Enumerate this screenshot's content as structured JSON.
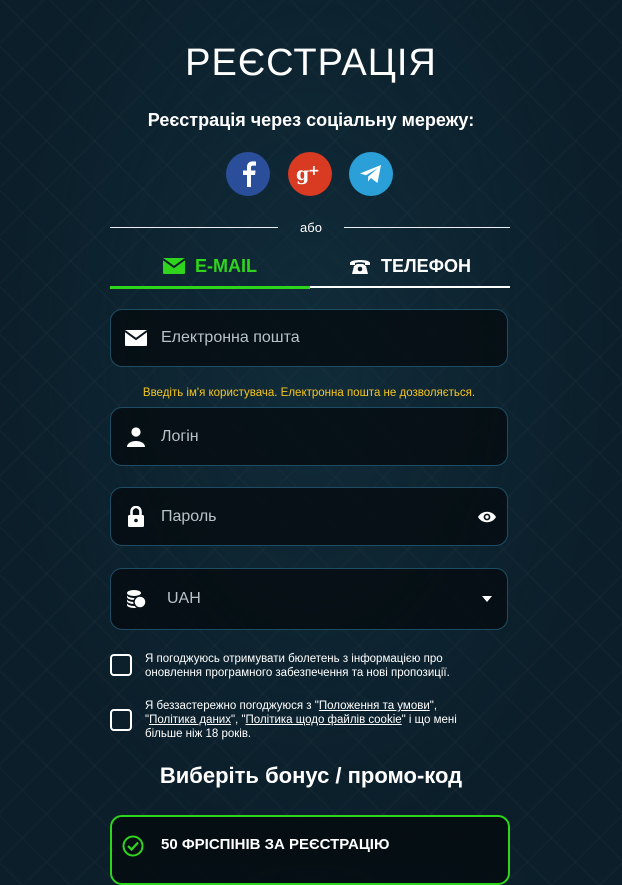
{
  "page": {
    "title": "РЕЄСТРАЦІЯ",
    "social_heading": "Реєстрація через соціальну мережу:",
    "social": [
      {
        "name": "facebook",
        "icon": "facebook-icon",
        "color": "#2b4e9a"
      },
      {
        "name": "google-plus",
        "icon": "google-plus-icon",
        "color": "#d83a22"
      },
      {
        "name": "telegram",
        "icon": "telegram-icon",
        "color": "#2b9fd8"
      }
    ],
    "divider_text": "або"
  },
  "tabs": [
    {
      "label": "E-MAIL",
      "icon": "envelope-icon",
      "active": true
    },
    {
      "label": "ТЕЛЕФОН",
      "icon": "phone-icon",
      "active": false
    }
  ],
  "colors": {
    "accent_green": "#2fd41c",
    "hint_yellow": "#f5c51d"
  },
  "form": {
    "email": {
      "placeholder": "Електронна пошта",
      "icon": "envelope-icon"
    },
    "login_hint": "Введіть ім'я користувача. Електронна пошта не дозволяється.",
    "login": {
      "placeholder": "Логін",
      "icon": "user-icon"
    },
    "password": {
      "placeholder": "Пароль",
      "icon": "lock-icon",
      "toggle_icon": "eye-icon"
    },
    "currency": {
      "value": "UAH",
      "icon": "coins-icon",
      "dropdown_icon": "caret-down-icon"
    }
  },
  "consents": {
    "newsletter": "Я погоджуюсь отримувати бюлетень з інформацією про оновлення програмного забезпечення та нові пропозиції.",
    "terms": {
      "prefix": "Я беззастережно погоджуюся з \"",
      "link1": "Положення та умови",
      "sep1": "\", \"",
      "link2": "Політика даних",
      "sep2": "\", \"",
      "link3": "Політика щодо файлів cookie",
      "suffix": "\" і що мені більше ніж 18 років."
    }
  },
  "bonus": {
    "title": "Виберіть бонус / промо-код",
    "option": "50 ФРІСПІНІВ ЗА РЕЄСТРАЦІЮ"
  }
}
